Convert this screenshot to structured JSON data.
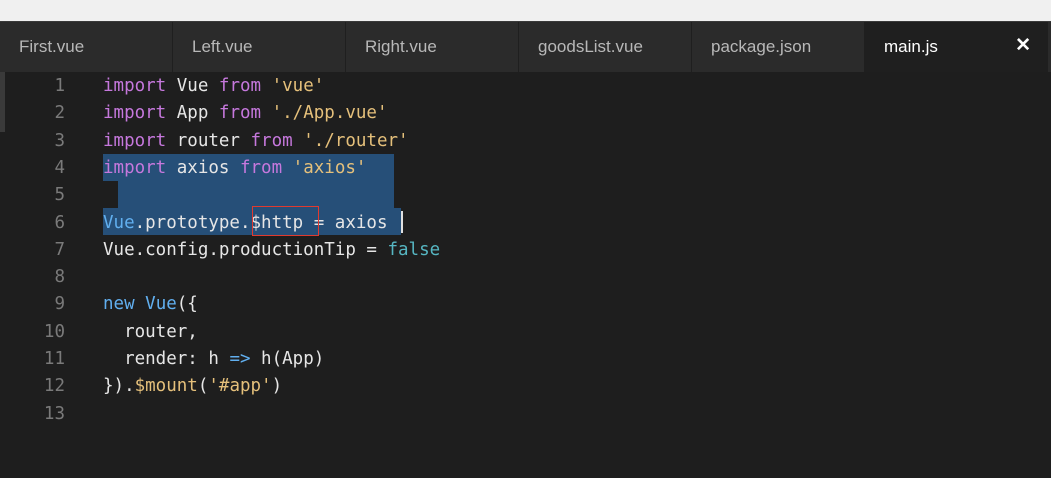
{
  "tabs": [
    {
      "label": "First.vue"
    },
    {
      "label": "Left.vue"
    },
    {
      "label": "Right.vue"
    },
    {
      "label": "goodsList.vue"
    },
    {
      "label": "package.json"
    },
    {
      "label": "main.js",
      "active": true
    }
  ],
  "close_glyph": "✕",
  "lines": [
    {
      "n": "1",
      "t": [
        [
          "kw",
          "import"
        ],
        [
          "id",
          " Vue "
        ],
        [
          "kw",
          "from"
        ],
        [
          "str",
          " 'vue'"
        ]
      ]
    },
    {
      "n": "2",
      "t": [
        [
          "kw",
          "import"
        ],
        [
          "id",
          " App "
        ],
        [
          "kw",
          "from"
        ],
        [
          "str",
          " './App.vue'"
        ]
      ]
    },
    {
      "n": "3",
      "t": [
        [
          "kw",
          "import"
        ],
        [
          "id",
          " router "
        ],
        [
          "kw",
          "from"
        ],
        [
          "str",
          " './router'"
        ]
      ]
    },
    {
      "n": "4",
      "t": [
        [
          "kw",
          "import"
        ],
        [
          "id",
          " axios "
        ],
        [
          "kw",
          "from"
        ],
        [
          "str",
          " 'axios'"
        ]
      ]
    },
    {
      "n": "5",
      "t": []
    },
    {
      "n": "6",
      "t": [
        [
          "kw2",
          "Vue"
        ],
        [
          "id",
          ".prototype."
        ],
        [
          "id",
          "$http"
        ],
        [
          "id",
          " = axios"
        ]
      ]
    },
    {
      "n": "7",
      "t": [
        [
          "id",
          "Vue.config.productionTip = "
        ],
        [
          "bool",
          "false"
        ]
      ]
    },
    {
      "n": "8",
      "t": []
    },
    {
      "n": "9",
      "t": [
        [
          "kw2",
          "new"
        ],
        [
          "id",
          " "
        ],
        [
          "kw2",
          "Vue"
        ],
        [
          "id",
          "({"
        ]
      ]
    },
    {
      "n": "10",
      "t": [
        [
          "id",
          "  router,"
        ]
      ]
    },
    {
      "n": "11",
      "t": [
        [
          "id",
          "  render: h "
        ],
        [
          "kw2",
          "=>"
        ],
        [
          "id",
          " h(App)"
        ]
      ]
    },
    {
      "n": "12",
      "t": [
        [
          "id",
          "})."
        ],
        [
          "str",
          "$mount"
        ],
        [
          "id",
          "("
        ],
        [
          "str",
          "'#app'"
        ],
        [
          "id",
          ")"
        ]
      ]
    },
    {
      "n": "13",
      "t": []
    }
  ]
}
